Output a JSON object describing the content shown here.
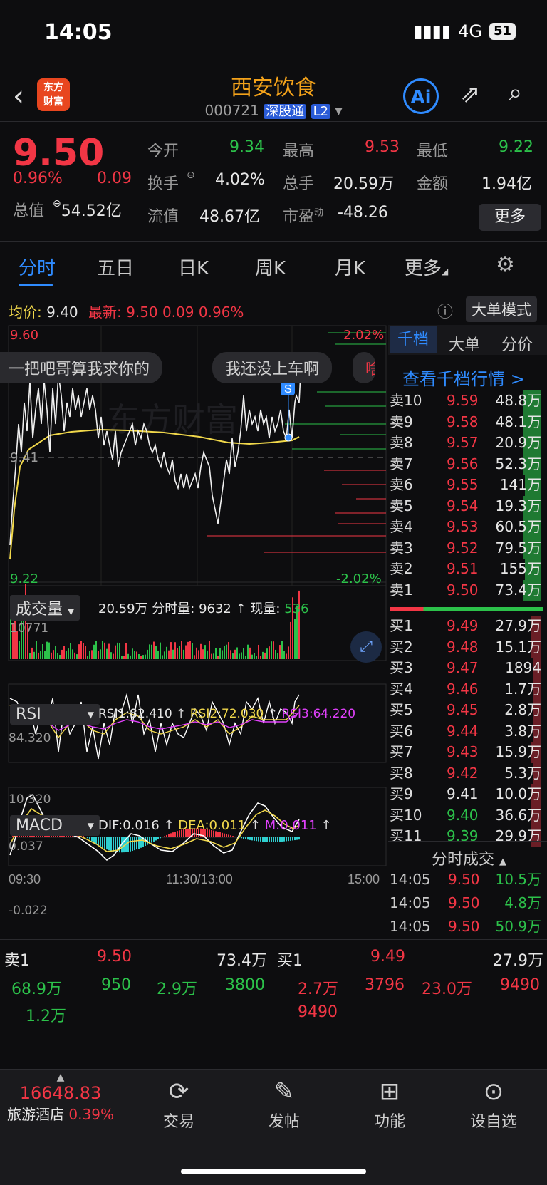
{
  "status": {
    "time": "14:05",
    "network": "4G",
    "battery": "51"
  },
  "header": {
    "name": "西安饮食",
    "code": "000721",
    "tag1": "深股通",
    "tag2": "L2",
    "logo_line1": "东方",
    "logo_line2": "财富",
    "ai": "Ai"
  },
  "quote": {
    "price": "9.50",
    "pct": "0.96%",
    "chg": "0.09",
    "open_label": "今开",
    "open": "9.34",
    "high_label": "最高",
    "high": "9.53",
    "low_label": "最低",
    "low": "9.22",
    "turnover_label": "换手",
    "turnover": "4.02%",
    "volume_label": "总手",
    "volume": "20.59万",
    "amount_label": "金额",
    "amount": "1.94亿",
    "mcap_label": "总值",
    "mcap": "54.52亿",
    "float_label": "流值",
    "float": "48.67亿",
    "pe_label": "市盈",
    "pe_sup": "动",
    "pe": "-48.26",
    "more": "更多"
  },
  "tabs": [
    "分时",
    "五日",
    "日K",
    "周K",
    "月K",
    "更多"
  ],
  "info_bar": {
    "avg_label": "均价:",
    "avg": "9.40",
    "last_label": "最新:",
    "last": "9.50",
    "chg": "0.09",
    "pct": "0.96%",
    "mode": "大单模式"
  },
  "chart": {
    "top_price": "9.60",
    "mid_price": "9.41",
    "low_price": "9.22",
    "top_pct": "2.02%",
    "low_pct": "-2.02%",
    "comment1": "一把吧哥算我求你的",
    "comment2": "我还没上车啊",
    "comment3": "啥",
    "watermark": "东方财富",
    "s_marker": "S"
  },
  "volume_panel": {
    "label": "成交量",
    "total": "20.59万",
    "fs_label": "分时量:",
    "fs": "9632",
    "now_label": "现量:",
    "now": "536",
    "max": "10771"
  },
  "rsi_panel": {
    "label": "RSI",
    "rsi1": "RSI1:82.410",
    "rsi2": "RSI2:72.030",
    "rsi3": "RSI3:64.220",
    "top": "84.320",
    "bottom": "10.320"
  },
  "macd_panel": {
    "label": "MACD",
    "dif": "DIF:0.016",
    "dea": "DEA:0.011",
    "m": "M:0.011",
    "top": "0.037",
    "bottom": "-0.022"
  },
  "time_axis": {
    "start": "09:30",
    "mid": "11:30/13:00",
    "end": "15:00"
  },
  "depth": {
    "tabs": [
      "千档",
      "大单",
      "分价"
    ],
    "link": "查看千档行情 >",
    "asks": [
      {
        "label": "卖10",
        "price": "9.59",
        "vol": "48.8万"
      },
      {
        "label": "卖9",
        "price": "9.58",
        "vol": "48.1万"
      },
      {
        "label": "卖8",
        "price": "9.57",
        "vol": "20.9万"
      },
      {
        "label": "卖7",
        "price": "9.56",
        "vol": "52.3万"
      },
      {
        "label": "卖6",
        "price": "9.55",
        "vol": "141万"
      },
      {
        "label": "卖5",
        "price": "9.54",
        "vol": "19.3万"
      },
      {
        "label": "卖4",
        "price": "9.53",
        "vol": "60.5万"
      },
      {
        "label": "卖3",
        "price": "9.52",
        "vol": "79.5万"
      },
      {
        "label": "卖2",
        "price": "9.51",
        "vol": "155万"
      },
      {
        "label": "卖1",
        "price": "9.50",
        "vol": "73.4万"
      }
    ],
    "bids": [
      {
        "label": "买1",
        "price": "9.49",
        "vol": "27.9万"
      },
      {
        "label": "买2",
        "price": "9.48",
        "vol": "15.1万"
      },
      {
        "label": "买3",
        "price": "9.47",
        "vol": "1894"
      },
      {
        "label": "买4",
        "price": "9.46",
        "vol": "1.7万"
      },
      {
        "label": "买5",
        "price": "9.45",
        "vol": "2.8万"
      },
      {
        "label": "买6",
        "price": "9.44",
        "vol": "3.8万"
      },
      {
        "label": "买7",
        "price": "9.43",
        "vol": "15.9万"
      },
      {
        "label": "买8",
        "price": "9.42",
        "vol": "5.3万"
      },
      {
        "label": "买9",
        "price": "9.41",
        "vol": "10.0万"
      },
      {
        "label": "买10",
        "price": "9.40",
        "vol": "36.6万"
      },
      {
        "label": "买11",
        "price": "9.39",
        "vol": "29.9万"
      }
    ],
    "trades_title": "分时成交",
    "trades": [
      {
        "time": "14:05",
        "price": "9.50",
        "vol": "10.5万"
      },
      {
        "time": "14:05",
        "price": "9.50",
        "vol": "4.8万"
      },
      {
        "time": "14:05",
        "price": "9.50",
        "vol": "50.9万"
      }
    ]
  },
  "queue": {
    "sell_label": "卖1",
    "sell_price": "9.50",
    "sell_vol": "73.4万",
    "buy_label": "买1",
    "buy_price": "9.49",
    "buy_vol": "27.9万",
    "sell_orders": [
      "68.9万",
      "950",
      "2.9万",
      "3800",
      "1.2万"
    ],
    "buy_orders": [
      "2.7万",
      "3796",
      "23.0万",
      "9490",
      "9490"
    ]
  },
  "bottom_nav": {
    "index_value": "16648.83",
    "index_name": "旅游酒店",
    "index_pct": "0.39%",
    "trade": "交易",
    "post": "发帖",
    "func": "功能",
    "watch": "设自选"
  },
  "colors": {
    "up": "#f23645",
    "down": "#2cc14a",
    "accent": "#2f8bff",
    "title": "#f3a21a"
  }
}
